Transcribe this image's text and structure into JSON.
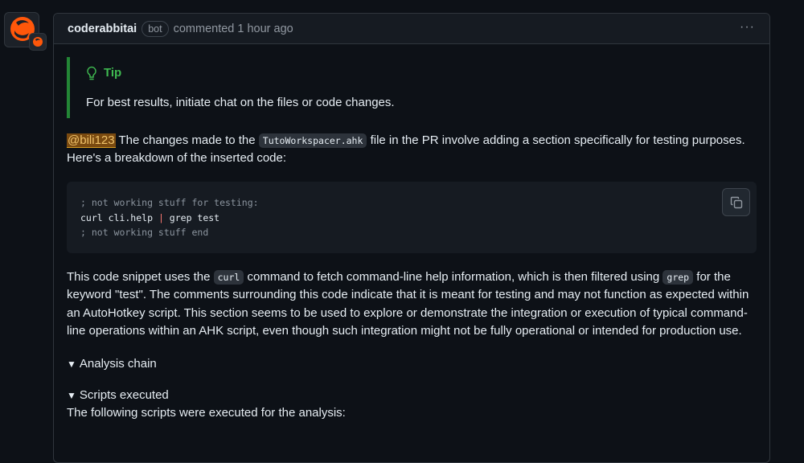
{
  "comment": {
    "author": "coderabbitai",
    "badge": "bot",
    "meta": "commented 1 hour ago",
    "menu_label": "···"
  },
  "tip": {
    "title": "Tip",
    "text": "For best results, initiate chat on the files or code changes."
  },
  "paragraph1": {
    "mention": "@bili123",
    "text_before_code": " The changes made to the ",
    "code": "TutoWorkspacer.ahk",
    "text_after_code": " file in the PR involve adding a section specifically for testing purposes. Here's a breakdown of the inserted code:"
  },
  "code_block": {
    "line1": "; not working stuff for testing:",
    "line2_cmd": "curl cli.help ",
    "line2_pipe": "|",
    "line2_rest": " grep test",
    "line3": "; not working stuff end"
  },
  "paragraph2": {
    "part1": "This code snippet uses the ",
    "code1": "curl",
    "part2": " command to fetch command-line help information, which is then filtered using ",
    "code2": "grep",
    "part3": " for the keyword \"test\". The comments surrounding this code indicate that it is meant for testing and may not function as expected within an AutoHotkey script. This section seems to be used to explore or demonstrate the integration or execution of typical command-line operations within an AHK script, even though such integration might not be fully operational or intended for production use."
  },
  "details": [
    {
      "arrow": "▼",
      "label": "Analysis chain"
    },
    {
      "arrow": "▼",
      "label": "Scripts executed"
    }
  ],
  "scripts_text": "The following scripts were executed for the analysis:"
}
